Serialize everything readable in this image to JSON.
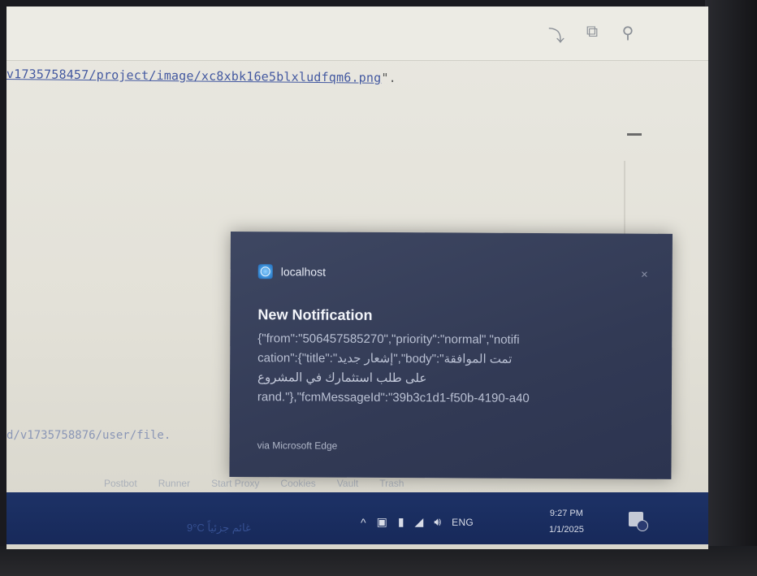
{
  "browser": {
    "toolbar_icons": [
      "share-icon",
      "copy-icon",
      "search-icon"
    ],
    "url_link": "v1735758457/project/image/xc8xbk16e5blxludfqm6.png",
    "url_tail": "\".",
    "url_link_2": "d/v1735758876/user/file."
  },
  "bottom_strip": {
    "items": [
      "Postbot",
      "Runner",
      "Start Proxy",
      "Cookies",
      "Vault",
      "Trash"
    ]
  },
  "notification": {
    "app_name": "localhost",
    "title": "New Notification",
    "body_line1": "{\"from\":\"506457585270\",\"priority\":\"normal\",\"notifi",
    "body_line2": "cation\":{\"title\":\"إشعار جديد\",\"body\":\"تمت الموافقة",
    "body_line3": "على طلب استثمارك في المشروع",
    "body_line4": "rand.\"},\"fcmMessageId\":\"39b3c1d1-f50b-4190-a40",
    "source": "via Microsoft Edge",
    "close_label": "×"
  },
  "taskbar": {
    "weather": "9°C  غائم جزئياً",
    "tray_chevron": "^",
    "language": "ENG",
    "time": "9:27 PM",
    "date": "1/1/2025"
  }
}
